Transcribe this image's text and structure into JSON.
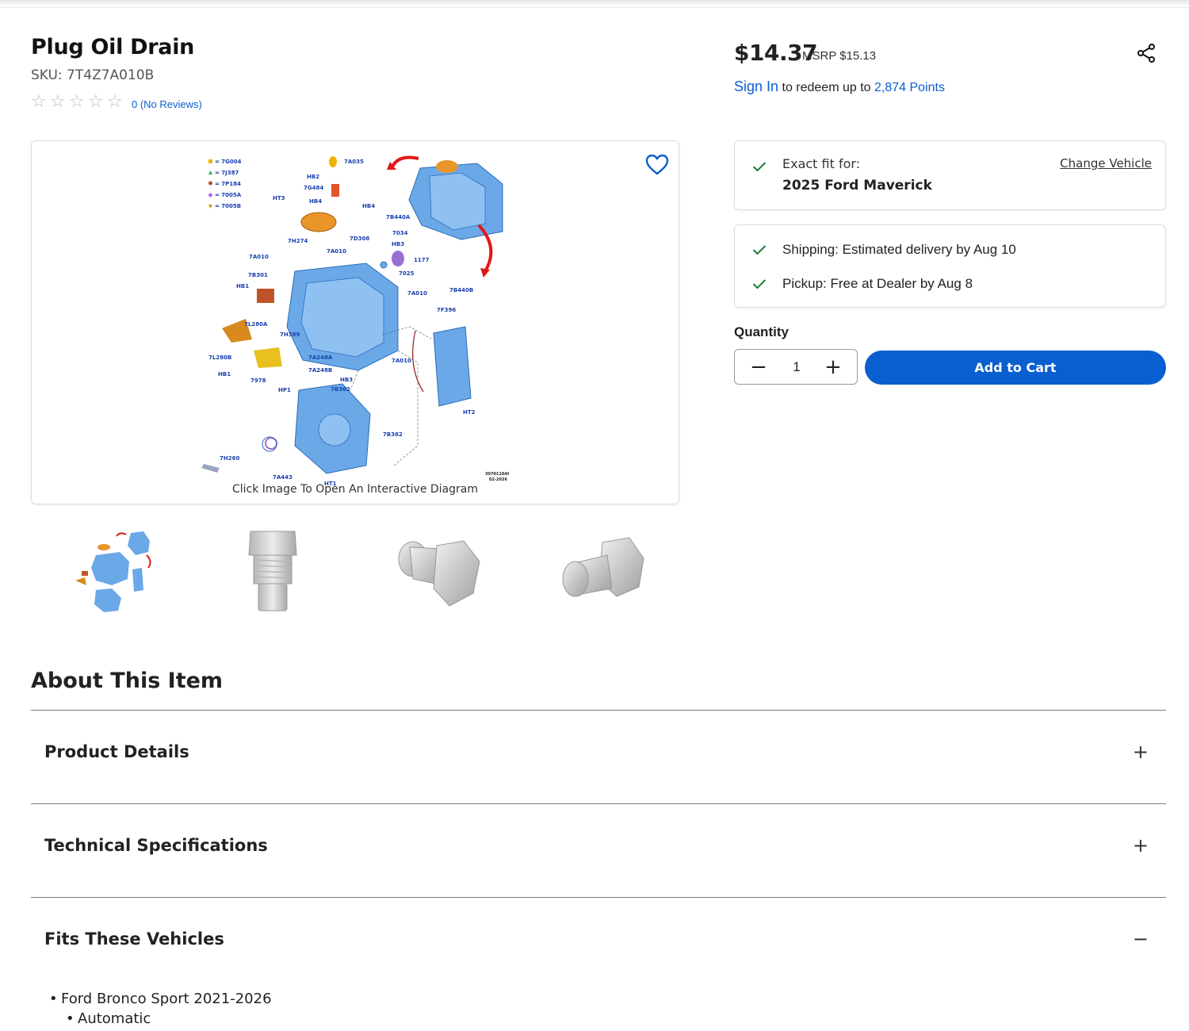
{
  "product": {
    "title": "Plug Oil Drain",
    "sku": "SKU: 7T4Z7A010B",
    "rating": 0,
    "reviews_label": "0 (No Reviews)"
  },
  "image": {
    "caption": "Click Image To Open An Interactive Diagram",
    "diagram_labels": [
      "7G004",
      "7J387",
      "7P184",
      "7005A",
      "7005B",
      "7A035",
      "HB2",
      "7G484",
      "HT3",
      "HB4",
      "HB4",
      "7B440A",
      "7H274",
      "7D308",
      "7034",
      "HB3",
      "7A010",
      "7A010",
      "1177",
      "7025",
      "7B301",
      "HB1",
      "7A010",
      "7B440B",
      "7F396",
      "7L280A",
      "7H389",
      "7L280B",
      "7A248A",
      "7A248B",
      "7A010",
      "HB1",
      "7978",
      "HB3",
      "HP1",
      "7B362",
      "HT2",
      "7B362",
      "7H260",
      "7A443",
      "HT1",
      "3070110AH",
      "02-2026"
    ],
    "thumbnails": [
      "diagram-thumb",
      "drain-plug-side",
      "drain-plug-angle",
      "drain-plug-profile"
    ]
  },
  "pricing": {
    "price": "$14.37",
    "msrp": "MSRP $15.13",
    "signin": "Sign In",
    "redeem_text": " to redeem up to ",
    "points": "2,874 Points"
  },
  "fitment": {
    "label": "Exact fit for:",
    "vehicle": "2025 Ford Maverick",
    "change_label": "Change Vehicle"
  },
  "delivery": {
    "shipping": "Shipping: Estimated delivery by Aug 10",
    "pickup": "Pickup: Free at Dealer by Aug 8"
  },
  "quantity": {
    "label": "Quantity",
    "value": "1",
    "minus": "−",
    "plus": "+"
  },
  "cart": {
    "label": "Add to Cart"
  },
  "about": {
    "heading": "About This Item",
    "sections": [
      {
        "title": "Product Details",
        "toggle": "+"
      },
      {
        "title": "Technical Specifications",
        "toggle": "+"
      },
      {
        "title": "Fits These Vehicles",
        "toggle": "−"
      }
    ],
    "fits": {
      "vehicle": "Ford Bronco Sport 2021-2026",
      "variant": "Automatic"
    }
  },
  "colors": {
    "accent_blue": "#0a5fd0",
    "check_green": "#1e7b34",
    "diagram_blue": "#6aa8e8"
  },
  "icons": [
    "heart-icon",
    "share-icon",
    "check-icon",
    "star-outline-icon",
    "plus-icon",
    "minus-icon"
  ]
}
